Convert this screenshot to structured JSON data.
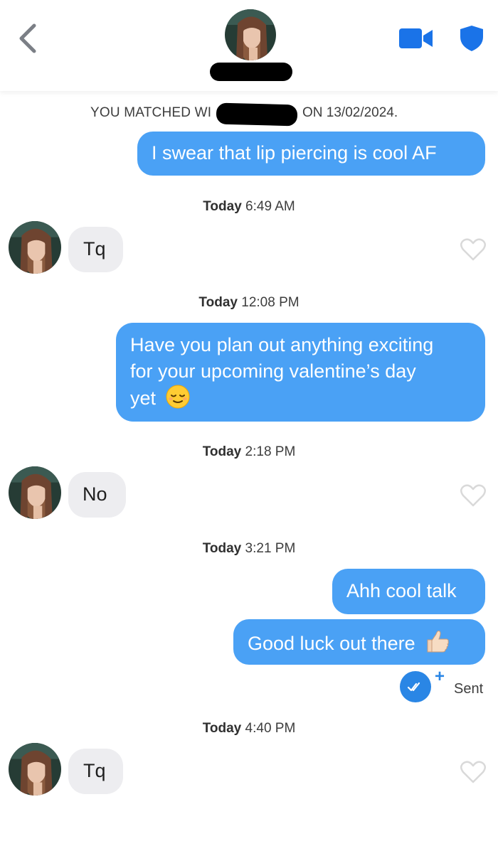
{
  "header": {
    "back_icon": "chevron-left-icon",
    "video_icon": "video-camera-icon",
    "safety_icon": "shield-icon",
    "accent_color": "#1a73e8"
  },
  "match": {
    "prefix": "YOU MATCHED WI",
    "suffix": "ON 13/02/2024."
  },
  "messages": [
    {
      "type": "out",
      "text": "I swear that lip piercing is cool AF"
    },
    {
      "type": "timestamp",
      "day": "Today",
      "time": "6:49 AM"
    },
    {
      "type": "in",
      "text": "Tq"
    },
    {
      "type": "timestamp",
      "day": "Today",
      "time": "12:08 PM"
    },
    {
      "type": "out",
      "lines": [
        "Have you plan out anything exciting",
        "for your upcoming valentine’s day",
        "yet"
      ],
      "emoji": "relieved-face"
    },
    {
      "type": "timestamp",
      "day": "Today",
      "time": "2:18 PM"
    },
    {
      "type": "in",
      "text": "No"
    },
    {
      "type": "timestamp",
      "day": "Today",
      "time": "3:21 PM"
    },
    {
      "type": "out",
      "text": "Ahh cool talk"
    },
    {
      "type": "out",
      "text": "Good luck out there",
      "emoji": "thumbs-up"
    },
    {
      "type": "status",
      "label": "Sent",
      "plus": "+"
    },
    {
      "type": "timestamp",
      "day": "Today",
      "time": "4:40 PM"
    },
    {
      "type": "in",
      "text": "Tq"
    }
  ],
  "colors": {
    "outgoing_bubble": "#4aa1f5",
    "incoming_bubble": "#ededf0",
    "heart_outline": "#d9d9d9"
  }
}
